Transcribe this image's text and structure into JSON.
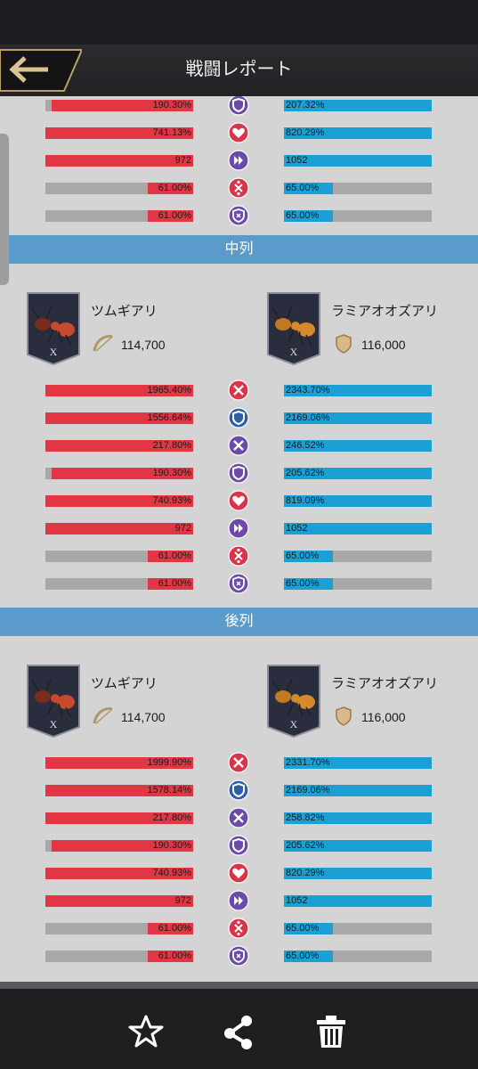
{
  "header": {
    "title": "戦闘レポート"
  },
  "top_rows": [
    {
      "icon": "shield-icon",
      "left": "190.30%",
      "right": "207.32%",
      "lpct": 0.96,
      "rpct": 1.0,
      "lcolor": "red"
    },
    {
      "icon": "heart-icon",
      "left": "741.13%",
      "right": "820.29%",
      "lpct": 1.0,
      "rpct": 1.0,
      "lcolor": "red"
    },
    {
      "icon": "speed-icon",
      "left": "972",
      "right": "1052",
      "lpct": 1.0,
      "rpct": 1.0,
      "lcolor": "red"
    },
    {
      "icon": "crit-icon",
      "left": "61.00%",
      "right": "65.00%",
      "lpct": 0.31,
      "rpct": 0.33,
      "lcolor": "red"
    },
    {
      "icon": "crit-resist-icon",
      "left": "61.00%",
      "right": "65.00%",
      "lpct": 0.31,
      "rpct": 0.33,
      "lcolor": "red"
    }
  ],
  "sections": [
    {
      "title": "中列",
      "left_unit": {
        "name": "ツムギアリ",
        "power": "114,700",
        "rank": "X"
      },
      "right_unit": {
        "name": "ラミアオオズアリ",
        "power": "116,000",
        "rank": "X"
      },
      "rows": [
        {
          "icon": "attack-icon",
          "left": "1965.40%",
          "right": "2343.70%",
          "lpct": 1.0,
          "rpct": 1.0
        },
        {
          "icon": "defense-icon",
          "left": "1556.64%",
          "right": "2169.06%",
          "lpct": 1.0,
          "rpct": 1.0
        },
        {
          "icon": "piercing-icon",
          "left": "217.80%",
          "right": "246.52%",
          "lpct": 1.0,
          "rpct": 1.0
        },
        {
          "icon": "shield-icon",
          "left": "190.30%",
          "right": "205.62%",
          "lpct": 0.96,
          "rpct": 1.0
        },
        {
          "icon": "heart-icon",
          "left": "740.93%",
          "right": "819.09%",
          "lpct": 1.0,
          "rpct": 1.0
        },
        {
          "icon": "speed-icon",
          "left": "972",
          "right": "1052",
          "lpct": 1.0,
          "rpct": 1.0
        },
        {
          "icon": "crit-icon",
          "left": "61.00%",
          "right": "65.00%",
          "lpct": 0.31,
          "rpct": 0.33
        },
        {
          "icon": "crit-resist-icon",
          "left": "61.00%",
          "right": "65.00%",
          "lpct": 0.31,
          "rpct": 0.33
        }
      ]
    },
    {
      "title": "後列",
      "left_unit": {
        "name": "ツムギアリ",
        "power": "114,700",
        "rank": "X"
      },
      "right_unit": {
        "name": "ラミアオオズアリ",
        "power": "116,000",
        "rank": "X"
      },
      "rows": [
        {
          "icon": "attack-icon",
          "left": "1999.90%",
          "right": "2331.70%",
          "lpct": 1.0,
          "rpct": 1.0
        },
        {
          "icon": "defense-icon",
          "left": "1578.14%",
          "right": "2169.06%",
          "lpct": 1.0,
          "rpct": 1.0
        },
        {
          "icon": "piercing-icon",
          "left": "217.80%",
          "right": "258.82%",
          "lpct": 1.0,
          "rpct": 1.0
        },
        {
          "icon": "shield-icon",
          "left": "190.30%",
          "right": "205.62%",
          "lpct": 0.96,
          "rpct": 1.0
        },
        {
          "icon": "heart-icon",
          "left": "740.93%",
          "right": "820.29%",
          "lpct": 1.0,
          "rpct": 1.0
        },
        {
          "icon": "speed-icon",
          "left": "972",
          "right": "1052",
          "lpct": 1.0,
          "rpct": 1.0
        },
        {
          "icon": "crit-icon",
          "left": "61.00%",
          "right": "65.00%",
          "lpct": 0.31,
          "rpct": 0.33
        },
        {
          "icon": "crit-resist-icon",
          "left": "61.00%",
          "right": "65.00%",
          "lpct": 0.31,
          "rpct": 0.33
        }
      ]
    }
  ],
  "pager": {
    "count": 2,
    "active": 0
  },
  "footer": {
    "buttons": [
      "favorite-button",
      "share-button",
      "delete-button"
    ]
  },
  "colors": {
    "left_bar": "#e23644",
    "right_bar": "#1aa0d4",
    "section": "#5b9bcb",
    "icon_red": "#d8344a",
    "icon_purple": "#6b4aa8",
    "icon_blue": "#2f5ea8"
  }
}
